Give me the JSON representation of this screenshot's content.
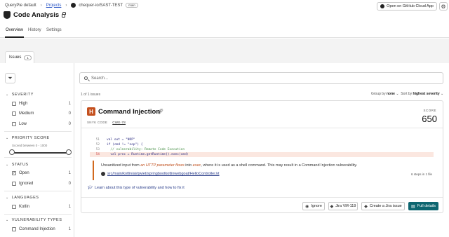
{
  "header": {
    "org": "QueryPie default",
    "projects_link": "Projects",
    "repo": "chequer-io/SAST-TEST",
    "branch": "main",
    "page_title": "Code Analysis",
    "open_github_label": "Open on GitHub Cloud App",
    "settings_icon": "gear-icon"
  },
  "tabs": [
    {
      "label": "Overview"
    },
    {
      "label": "History"
    },
    {
      "label": "Settings"
    }
  ],
  "issues_tab": {
    "label": "Issues",
    "count": "1"
  },
  "sidebar": {
    "severity": {
      "title": "SEVERITY",
      "items": [
        {
          "label": "High",
          "count": "1",
          "checked": false
        },
        {
          "label": "Medium",
          "count": "0",
          "checked": false
        },
        {
          "label": "Low",
          "count": "0",
          "checked": false
        }
      ]
    },
    "priority": {
      "title": "PRIORITY SCORE",
      "range_label": "Scored between 0 - 1000",
      "min": 0,
      "max": 1000
    },
    "status": {
      "title": "STATUS",
      "items": [
        {
          "label": "Open",
          "count": "1",
          "checked": true
        },
        {
          "label": "Ignored",
          "count": "0",
          "checked": false
        }
      ]
    },
    "languages": {
      "title": "LANGUAGES",
      "items": [
        {
          "label": "Kotlin",
          "count": "1",
          "checked": false
        }
      ]
    },
    "vuln_types": {
      "title": "VULNERABILITY TYPES",
      "items": [
        {
          "label": "Command Injection",
          "count": "1",
          "checked": false
        }
      ]
    }
  },
  "search": {
    "placeholder": "Search..."
  },
  "results": {
    "count_text": "1 of 1 issues",
    "group_by_label": "Group by",
    "group_by_value": "none",
    "sort_by_label": "Sort by",
    "sort_by_value": "highest severity"
  },
  "issue": {
    "severity_letter": "H",
    "title": "Command Injection",
    "source": "SNYK CODE",
    "cwe": "CWE-78",
    "score_label": "SCORE",
    "score": "650",
    "code_lines": [
      {
        "num": "51",
        "text": "val out = \"NOP\""
      },
      {
        "num": "52",
        "text": "if (cmd != \"nop\") {"
      },
      {
        "num": "53",
        "text": "  // vulnerability: Remote Code Execution"
      },
      {
        "num": "54",
        "text": "  val proc = Runtime.getRuntime().exec(cmd)"
      }
    ],
    "message_prefix": "Unsanitized input from ",
    "message_source": "an HTTP parameter flows",
    "message_into": " into ",
    "message_sink": "exec",
    "message_suffix": ", where it is used as a shell command. This may result in a Command Injection vulnerability.",
    "file_path": "src/main/kotlin/ai/qwiet/springbootkotlinwebgoat/HelloController.kt",
    "steps": "6 steps in 1 file",
    "learn_link": "Learn about this type of vulnerability and how to fix it",
    "actions": {
      "ignore": "Ignore",
      "jira_ticket": "Jira VM-119",
      "create_jira": "Create a Jira issue",
      "full_details": "Full details"
    }
  }
}
